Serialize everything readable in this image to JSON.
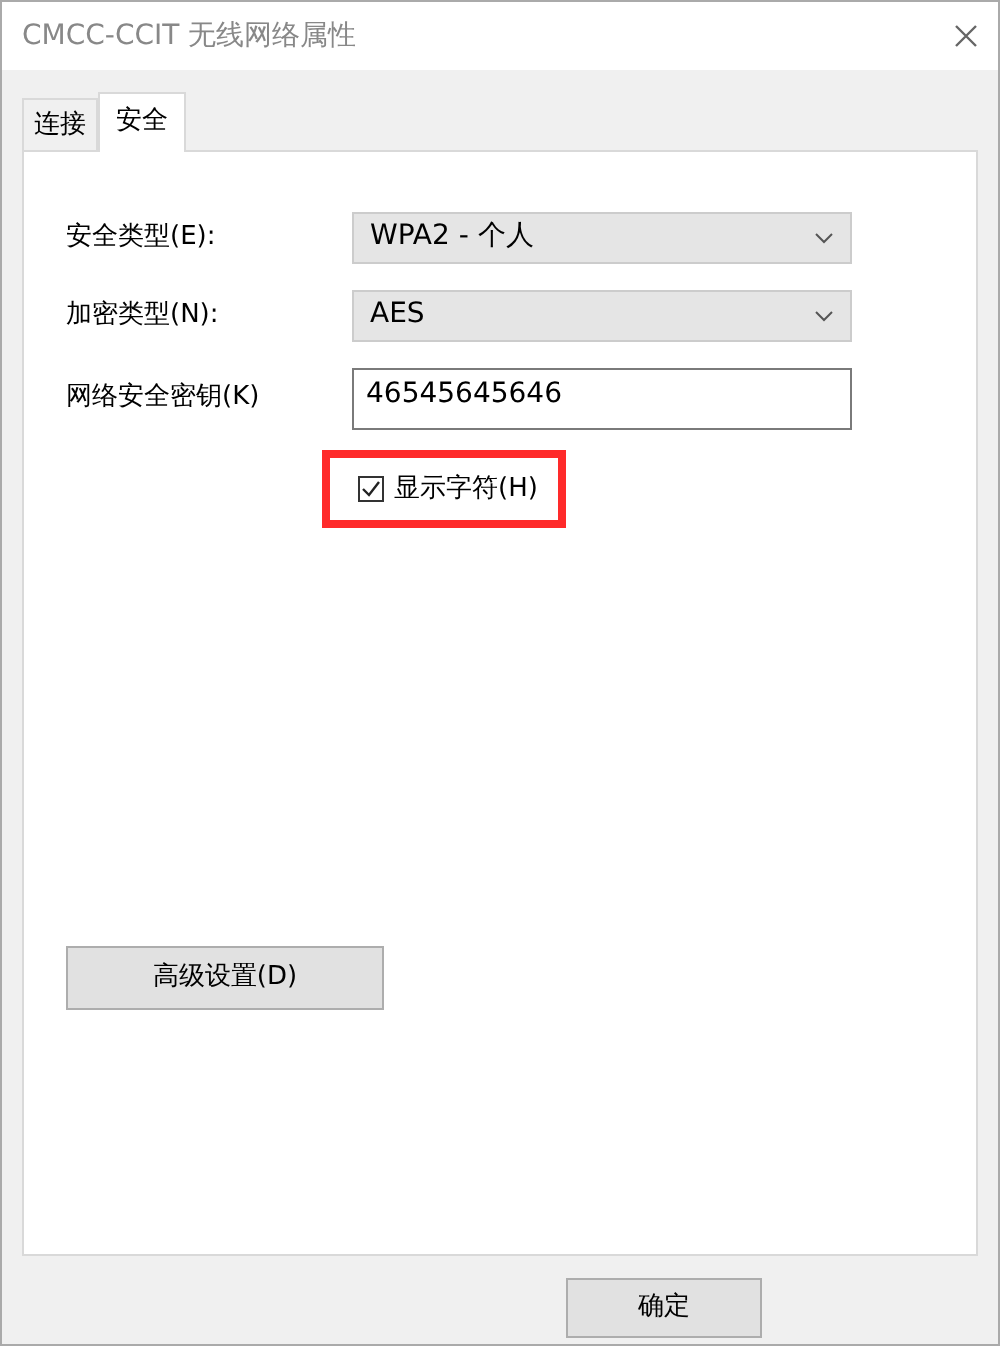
{
  "window": {
    "title": "CMCC-CCIT 无线网络属性"
  },
  "tabs": [
    {
      "label": "连接",
      "selected": false
    },
    {
      "label": "安全",
      "selected": true
    }
  ],
  "fields": [
    {
      "kind": "select",
      "label": "安全类型(E):",
      "value": "WPA2 - 个人"
    },
    {
      "kind": "select",
      "label": "加密类型(N):",
      "value": "AES"
    },
    {
      "kind": "text",
      "label": "网络安全密钥(K)",
      "value": "46545645646"
    }
  ],
  "show_characters": {
    "label": "显示字符(H)",
    "checked": true,
    "highlighted": true
  },
  "advanced_button": "高级设置(D)",
  "buttons": [
    "确定"
  ]
}
